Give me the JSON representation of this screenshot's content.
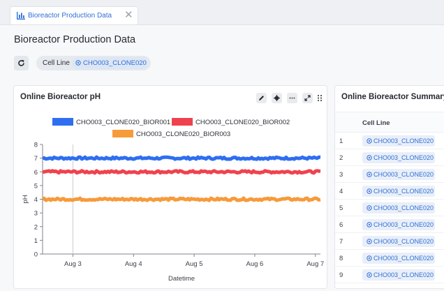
{
  "tab": {
    "label": "Bioreactor Production Data",
    "close": "✕"
  },
  "page": {
    "title": "Bioreactor Production Data"
  },
  "filter": {
    "label": "Cell Line",
    "value": "CHO003_CLONE020"
  },
  "ph_card": {
    "title": "Online Bioreactor pH",
    "toolbar": [
      "edit-icon",
      "settings-icon",
      "more-icon",
      "expand-icon",
      "drag-icon"
    ]
  },
  "summary_card": {
    "title": "Online Bioreactor Summary",
    "column_header": "Cell Line",
    "rows": [
      {
        "index": "1",
        "cell_line": "CHO003_CLONE020"
      },
      {
        "index": "2",
        "cell_line": "CHO003_CLONE020"
      },
      {
        "index": "3",
        "cell_line": "CHO003_CLONE020"
      },
      {
        "index": "4",
        "cell_line": "CHO003_CLONE020"
      },
      {
        "index": "5",
        "cell_line": "CHO003_CLONE020"
      },
      {
        "index": "6",
        "cell_line": "CHO003_CLONE020"
      },
      {
        "index": "7",
        "cell_line": "CHO003_CLONE020"
      },
      {
        "index": "8",
        "cell_line": "CHO003_CLONE020"
      },
      {
        "index": "9",
        "cell_line": "CHO003_CLONE020"
      }
    ]
  },
  "colors": {
    "accent": "#2f6fd6",
    "series1": "#2f6ef0",
    "series2": "#f0424e",
    "series3": "#f79a3a"
  },
  "chart_data": {
    "type": "line",
    "title": "",
    "xlabel": "Datetime",
    "ylabel": "pH",
    "x_ticks": [
      "Aug 3",
      "Aug 4",
      "Aug 5",
      "Aug 6",
      "Aug 7"
    ],
    "x_range": [
      "2022-08-02 12:00",
      "2022-08-07 02:00"
    ],
    "ylim": [
      0,
      8
    ],
    "y_ticks": [
      0,
      1,
      2,
      3,
      4,
      5,
      6,
      7,
      8
    ],
    "grid": "vertical line at Aug 3",
    "legend_position": "top",
    "series": [
      {
        "name": "CHO003_CLONE020_BIOR001",
        "color": "#2f6ef0",
        "mean": 7.0,
        "noise": 0.08
      },
      {
        "name": "CHO003_CLONE020_BIOR002",
        "color": "#f0424e",
        "mean": 6.0,
        "noise": 0.08
      },
      {
        "name": "CHO003_CLONE020_BIOR003",
        "color": "#f79a3a",
        "mean": 4.0,
        "noise": 0.08
      }
    ]
  }
}
